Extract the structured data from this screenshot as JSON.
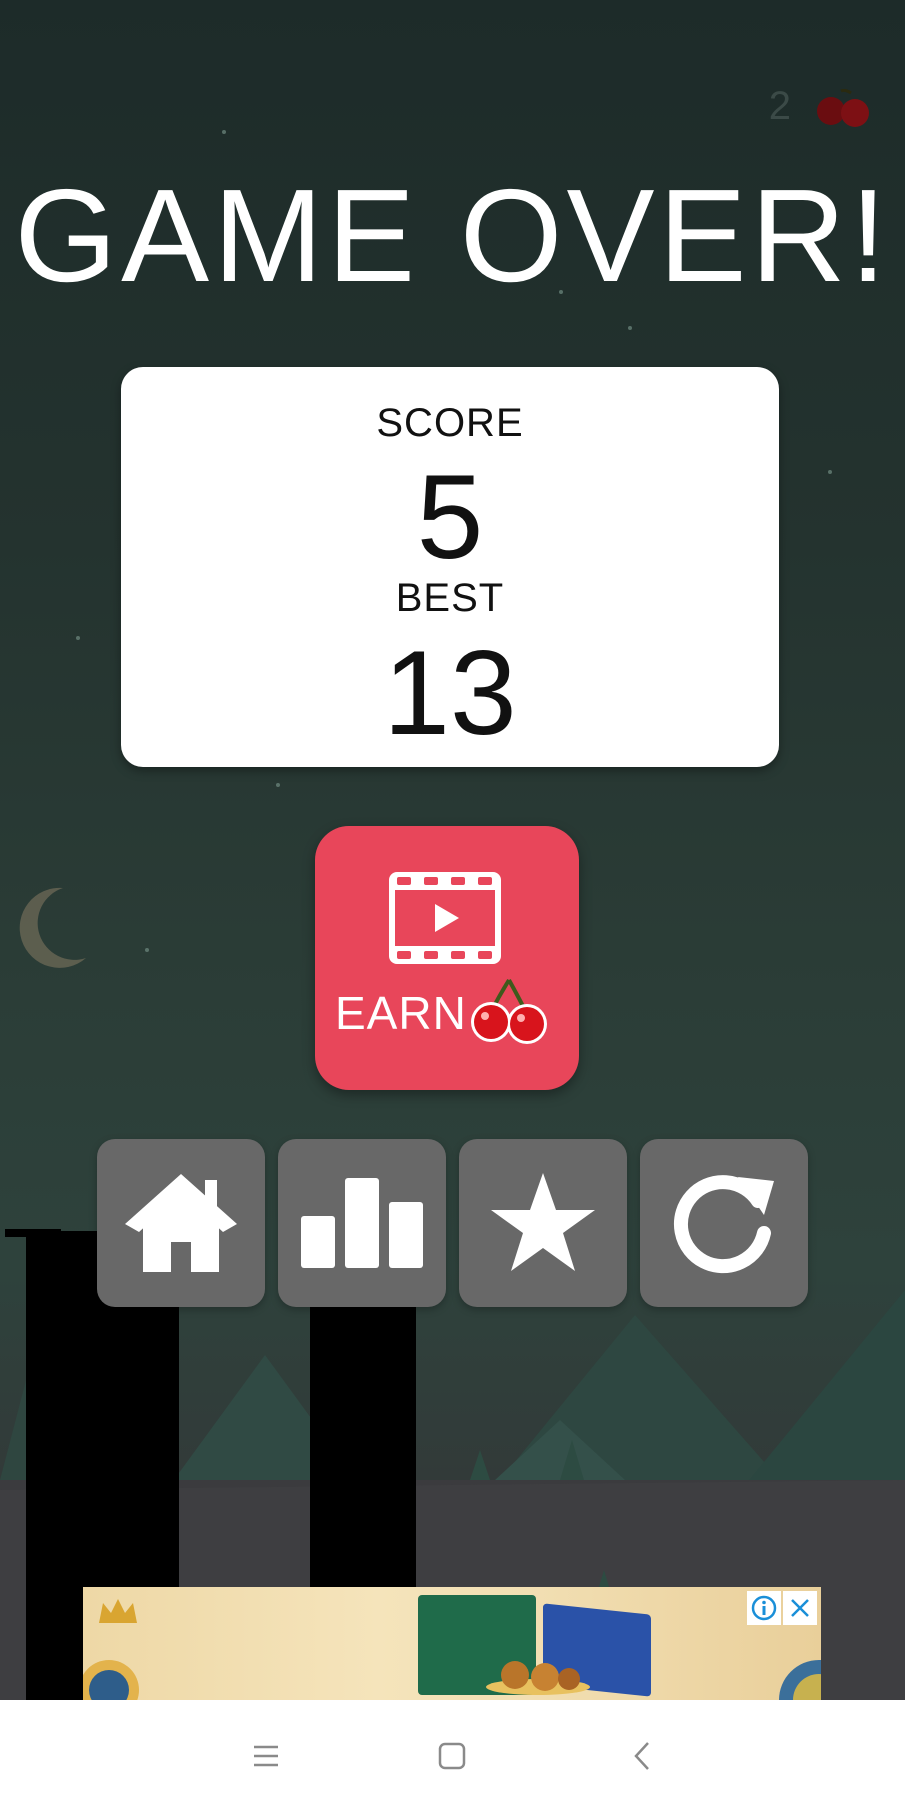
{
  "hud": {
    "cherries": "2",
    "cherry_icon": "cherry-icon"
  },
  "title": "GAME OVER!",
  "score_card": {
    "score_label": "SCORE",
    "score_value": "5",
    "best_label": "BEST",
    "best_value": "13"
  },
  "earn_button": {
    "label": "EARN",
    "icon": "video-icon",
    "reward_icon": "cherry-icon"
  },
  "actions": [
    {
      "name": "home",
      "icon": "home-icon"
    },
    {
      "name": "leaderboard",
      "icon": "bar-chart-icon"
    },
    {
      "name": "rate",
      "icon": "star-icon"
    },
    {
      "name": "restart",
      "icon": "restart-icon"
    }
  ],
  "ad": {
    "info_icon": "info-icon",
    "close_icon": "close-icon"
  },
  "navbar": {
    "items": [
      "menu-icon",
      "home-square-icon",
      "back-icon"
    ]
  },
  "colors": {
    "earn_button": "#e8465a",
    "tile": "#686868",
    "card": "#ffffff",
    "title": "#ffffff"
  }
}
